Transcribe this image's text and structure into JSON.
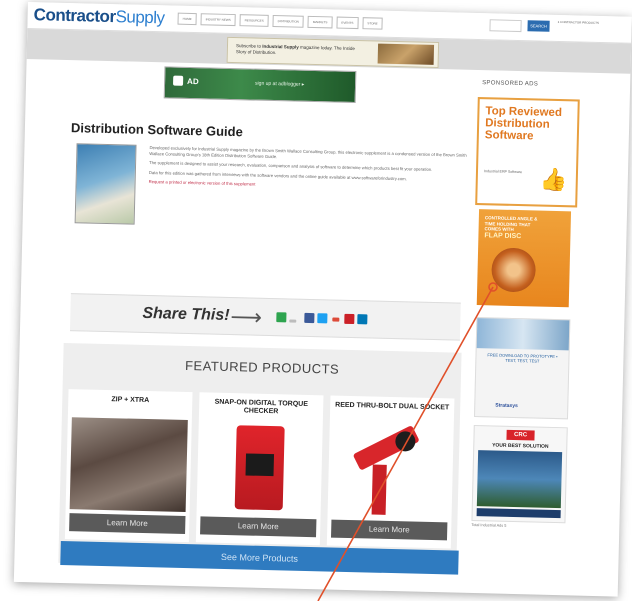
{
  "header": {
    "logo_main": "Contractor",
    "logo_accent": "Supply",
    "nav": [
      "HOME",
      "INDUSTRY NEWS",
      "RESOURCES",
      "DISTRIBUTION",
      "MARKETS",
      "EVENTS",
      "STORE"
    ],
    "search_button": "SEARCH",
    "top_links": "1 CONTRACTOR PRODUCTS"
  },
  "banner": {
    "ad_text_prefix": "Subscribe to ",
    "ad_text_bold": "Industrial Supply",
    "ad_text_suffix": " magazine today. The Inside Story of Distribution."
  },
  "sidebar": {
    "label": "SPONSORED ADS",
    "ad1_title": "Top Reviewed Distribution Software",
    "ad1_small": "Industrial ERP Software",
    "ad2_text": "CONTROLLED ANGLE & TIME HOLDING THAT COMES WITH",
    "ad2_sub": "FLAP DISC",
    "ad3_text": "FREE DOWNLOAD TO PROTOTYPE • TEST, TEST, TEST",
    "ad3_brand": "Stratasys",
    "ad4_logo": "CRC",
    "ad4_title": "YOUR BEST SOLUTION",
    "footer": "Total Industrial Ads 5"
  },
  "main": {
    "google_ad_label": "AD",
    "google_ad_cta": "sign up at adblogger ▸",
    "title": "Distribution Software Guide",
    "para1": "Developed exclusively for Industrial Supply magazine by the Brown Smith Wallace Consulting Group, this electronic supplement is a condensed version of the Brown Smith Wallace Consulting Group's 18th Edition Distribution Software Guide.",
    "para2": "The supplement is designed to assist your research, evaluation, comparison and analysis of software to determine which products best fit your operation.",
    "para3": "Data for this edition was gathered from interviews with the software vendors and the online guide available at www.softwareforindustry.com.",
    "link": "Request a printed or electronic version of this supplement",
    "share_label": "Share This!",
    "share_arrow": "⟶",
    "featured_title": "FEATURED PRODUCTS",
    "products": [
      {
        "name": "ZIP + XTRA",
        "cta": "Learn More"
      },
      {
        "name": "SNAP-ON DIGITAL TORQUE CHECKER",
        "cta": "Learn More"
      },
      {
        "name": "REED THRU-BOLT DUAL SOCKET",
        "cta": "Learn More"
      }
    ],
    "see_more": "See More Products"
  },
  "colors": {
    "brand_blue": "#1a4f8a",
    "accent_orange": "#e07820",
    "button_blue": "#2f7bc0",
    "annotation_line": "#e0502a"
  }
}
